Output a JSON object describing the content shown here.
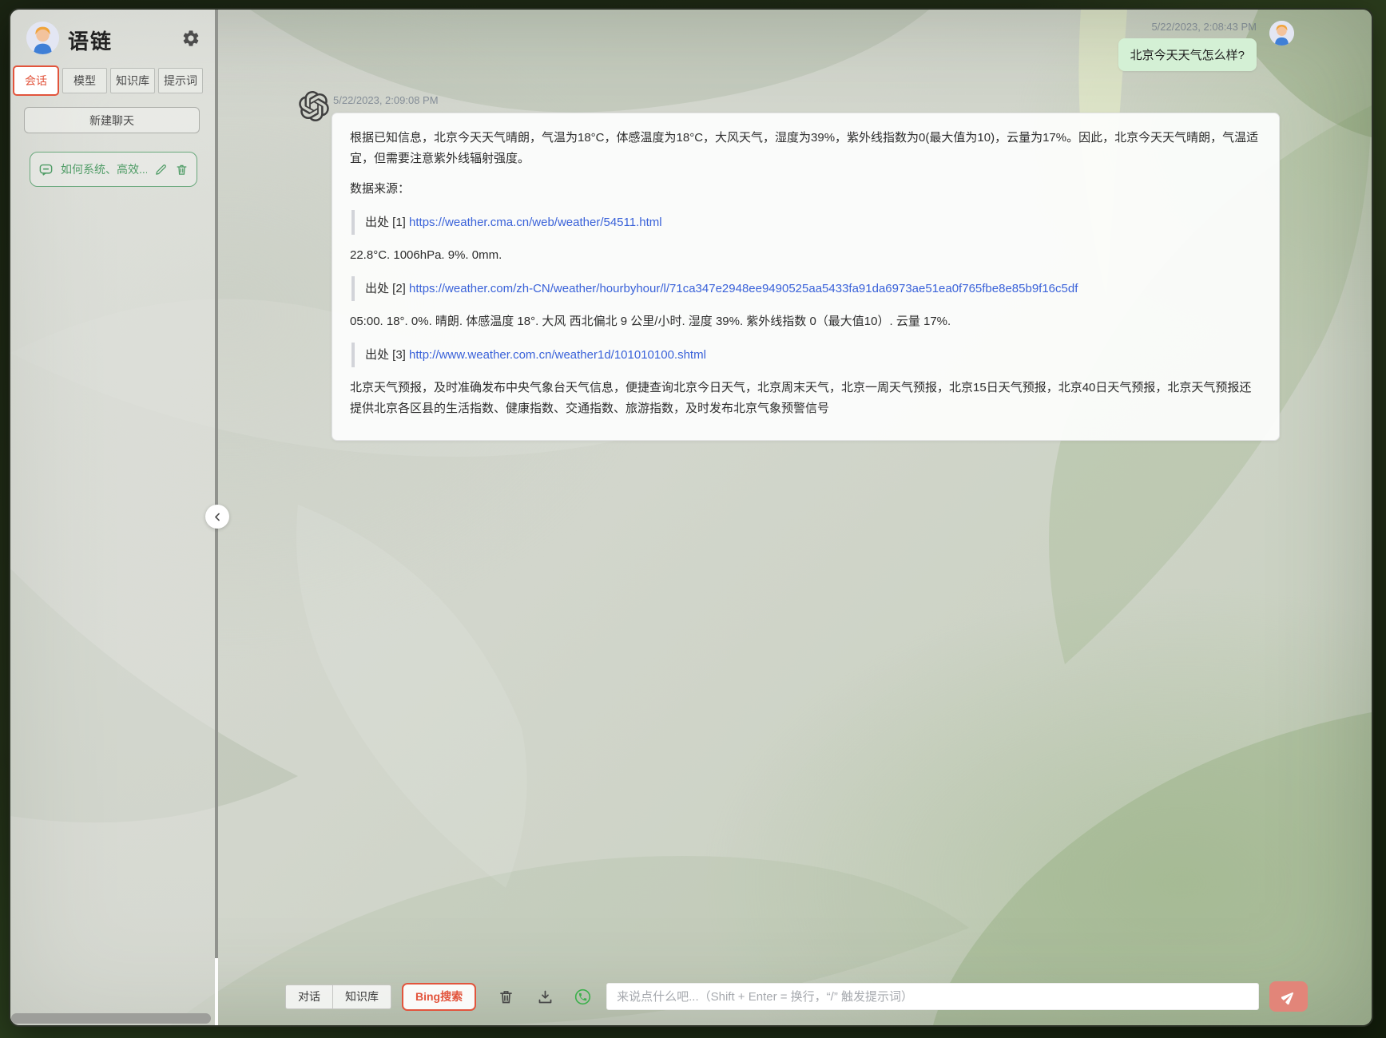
{
  "app": {
    "title": "语链"
  },
  "sidebar": {
    "tabs": [
      {
        "label": "会话",
        "active": true
      },
      {
        "label": "模型",
        "active": false
      },
      {
        "label": "知识库",
        "active": false
      },
      {
        "label": "提示词",
        "active": false
      }
    ],
    "new_chat_label": "新建聊天",
    "history": [
      {
        "title": "如何系统、高效..."
      }
    ]
  },
  "chat": {
    "user_message": {
      "timestamp": "5/22/2023, 2:08:43 PM",
      "text": "北京今天天气怎么样?"
    },
    "assistant_message": {
      "timestamp": "5/22/2023, 2:09:08 PM",
      "paragraph1": "根据已知信息，北京今天天气晴朗，气温为18°C，体感温度为18°C，大风天气，湿度为39%，紫外线指数为0(最大值为10)，云量为17%。因此，北京今天天气晴朗，气温适宜，但需要注意紫外线辐射强度。",
      "sources_label": "数据来源：",
      "sources": [
        {
          "label": "出处 [1]",
          "url": "https://weather.cma.cn/web/weather/54511.html"
        },
        {
          "label": "出处 [2]",
          "url": "https://weather.com/zh-CN/weather/hourbyhour/l/71ca347e2948ee9490525aa5433fa91da6973ae51ea0f765fbe8e85b9f16c5df"
        },
        {
          "label": "出处 [3]",
          "url": "http://www.weather.com.cn/weather1d/101010100.shtml"
        }
      ],
      "snippets": [
        "22.8°C. 1006hPa. 9%. 0mm.",
        "05:00. 18°. 0%. 晴朗. 体感温度 18°. 大风 西北偏北 9 公里/小时. 湿度 39%. 紫外线指数 0（最大值10）. 云量 17%.",
        "北京天气预报，及时准确发布中央气象台天气信息，便捷查询北京今日天气，北京周末天气，北京一周天气预报，北京15日天气预报，北京40日天气预报，北京天气预报还提供北京各区县的生活指数、健康指数、交通指数、旅游指数，及时发布北京气象预警信号"
      ]
    }
  },
  "composer": {
    "modes": [
      {
        "label": "对话"
      },
      {
        "label": "知识库"
      }
    ],
    "bing_label": "Bing搜索",
    "placeholder": "来说点什么吧...（Shift + Enter = 换行，“/” 触发提示词）"
  },
  "icons": {
    "gear-icon": "⚙ gear glyph",
    "chat-bubble-icon": "speech bubble outline",
    "edit-icon": "✎ pencil outline",
    "delete-icon": "trash can outline",
    "chevron-left-icon": "‹",
    "openai-logo-icon": "OpenAI knot mark",
    "trash-icon": "trash can outline",
    "download-icon": "tray with down arrow",
    "whatsapp-icon": "phone in circle",
    "send-icon": "paper plane"
  },
  "colors": {
    "accent_red": "#e2543c",
    "accent_green": "#55a06b",
    "user_bubble": "#d4f0d5",
    "link_blue": "#3a62d9",
    "send_button": "#e28579",
    "whatsapp_green": "#3db04c"
  }
}
